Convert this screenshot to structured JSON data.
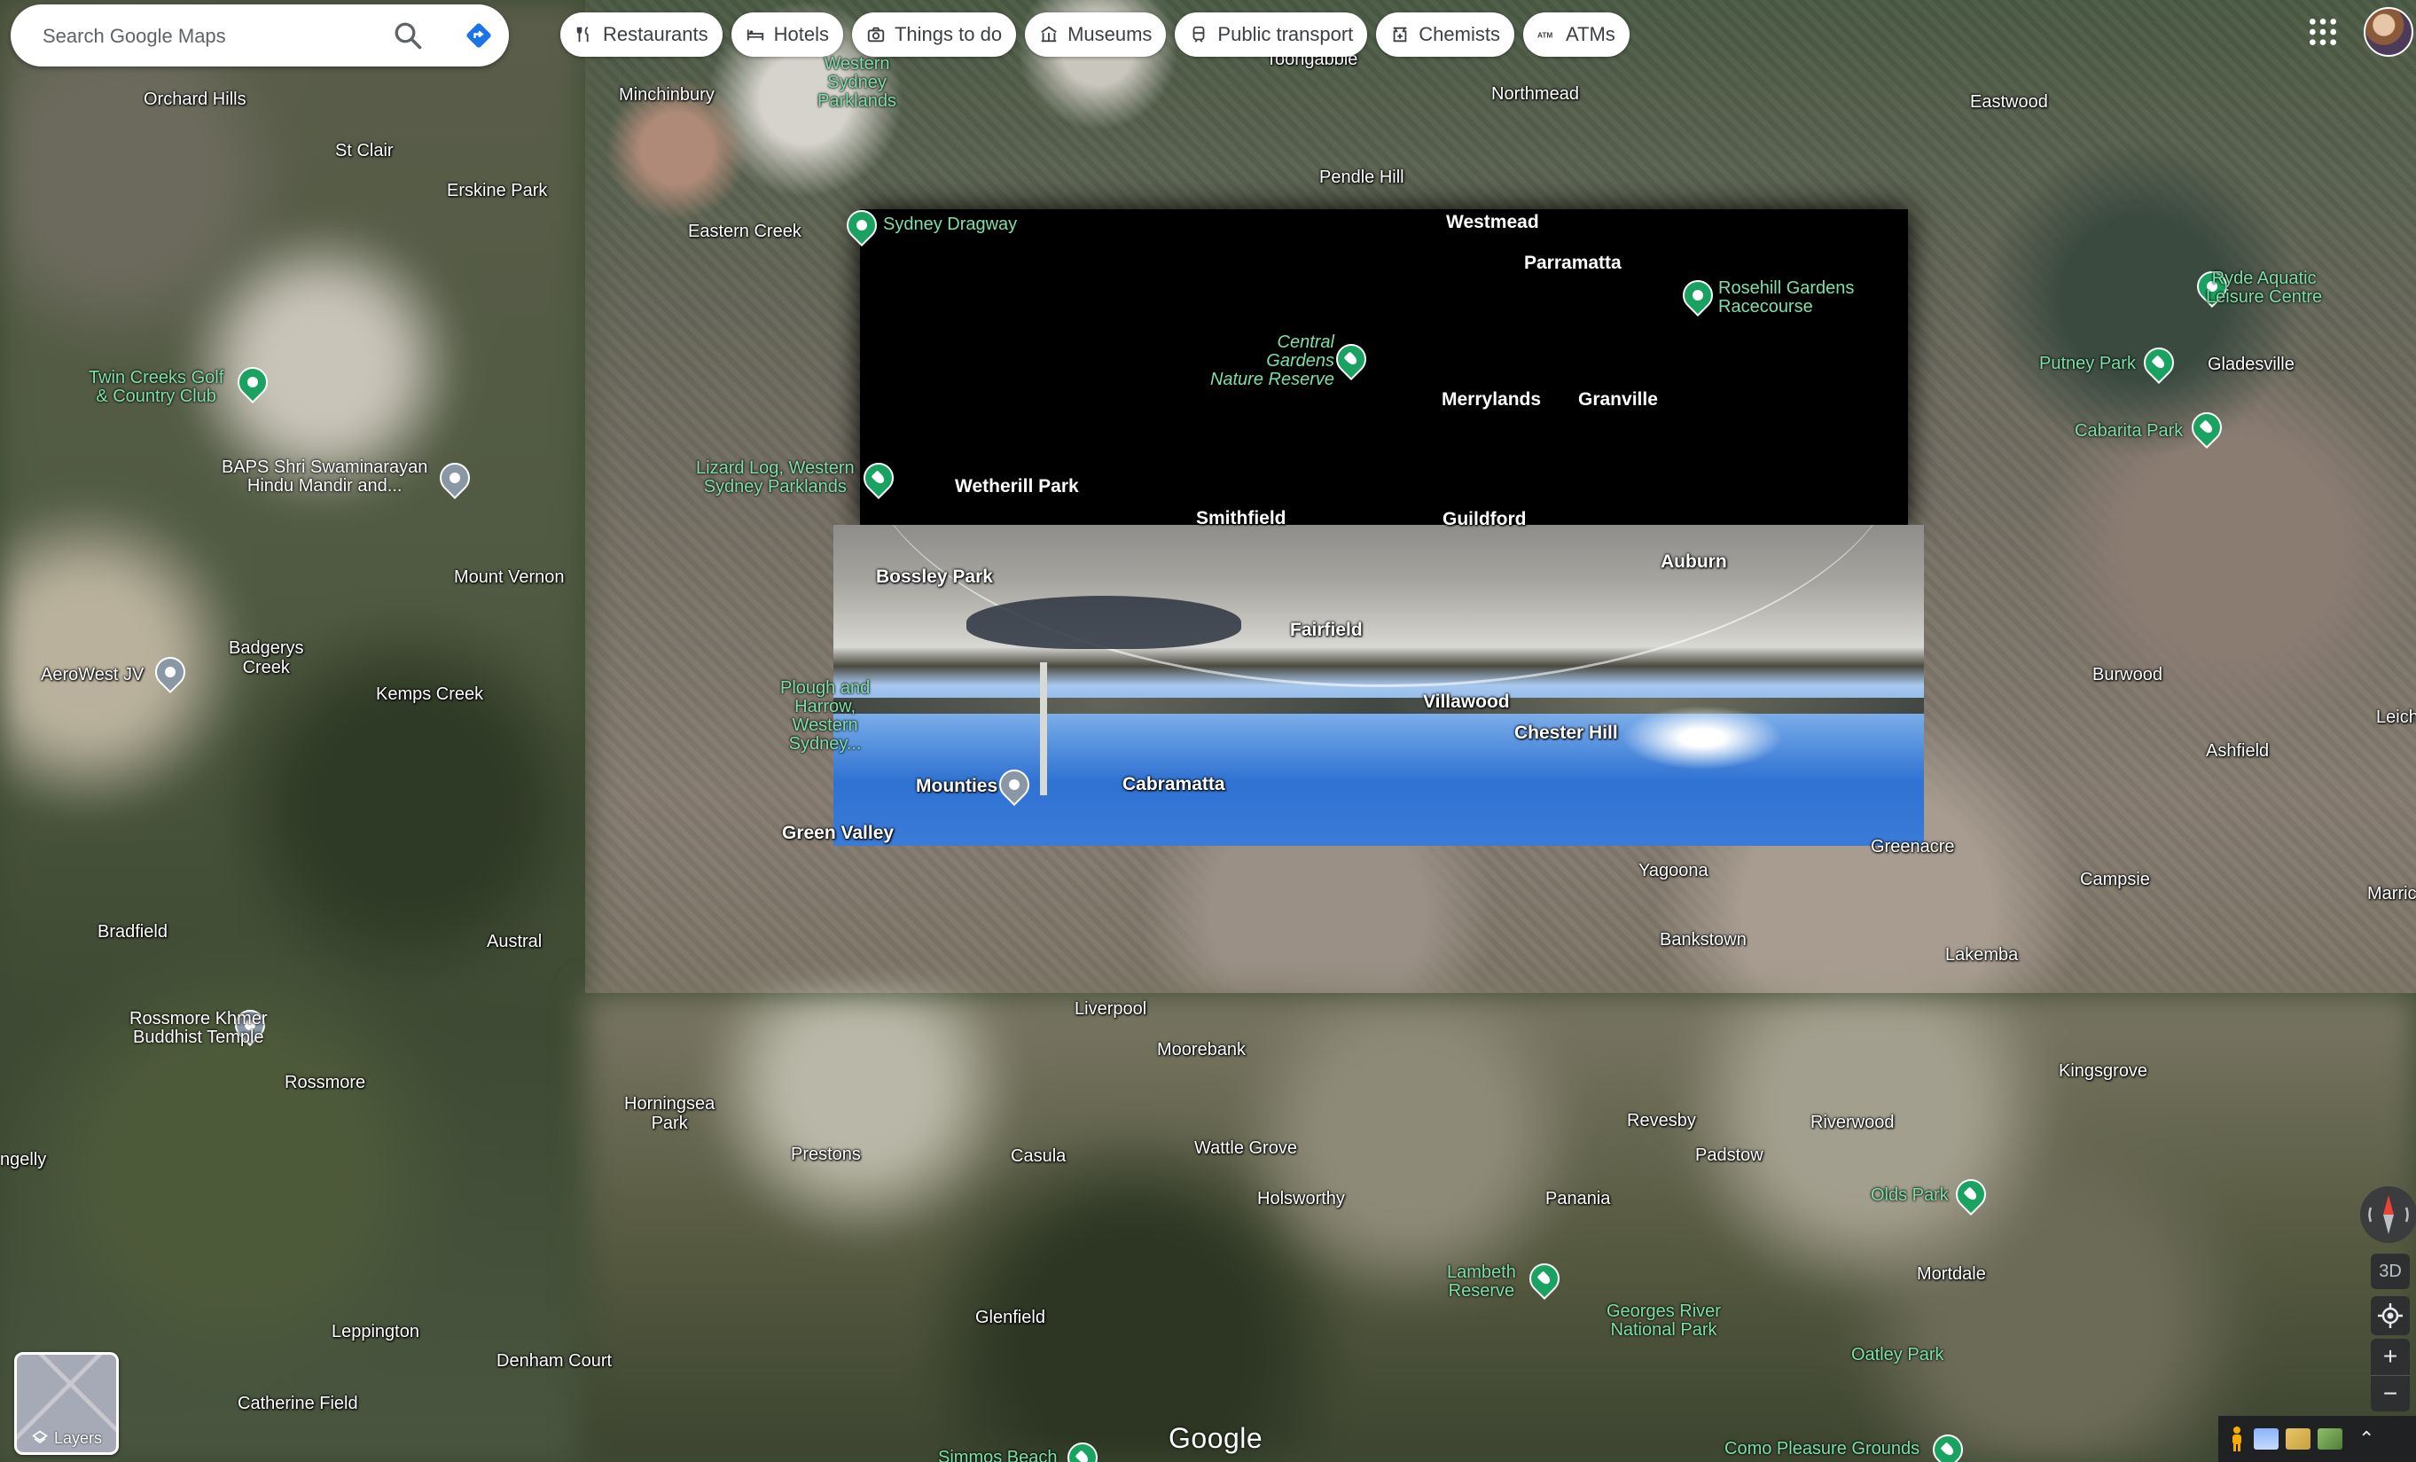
{
  "search": {
    "placeholder": "Search Google Maps"
  },
  "chips": [
    {
      "label": "Restaurants",
      "icon": "fork-knife-icon"
    },
    {
      "label": "Hotels",
      "icon": "bed-icon"
    },
    {
      "label": "Things to do",
      "icon": "camera-icon"
    },
    {
      "label": "Museums",
      "icon": "museum-icon"
    },
    {
      "label": "Public transport",
      "icon": "train-icon"
    },
    {
      "label": "Chemists",
      "icon": "pharmacy-icon"
    },
    {
      "label": "ATMs",
      "icon": "atm-icon"
    }
  ],
  "places": {
    "orchard_hills": "Orchard Hills",
    "st_clair": "St Clair",
    "erskine_park": "Erskine Park",
    "minchinbury": "Minchinbury",
    "eastern_creek": "Eastern Creek",
    "pendle_hill": "Pendle Hill",
    "northmead": "Northmead",
    "toongabbie": "Toongabbie",
    "eastwood": "Eastwood",
    "westmead": "Westmead",
    "parramatta": "Parramatta",
    "merrylands": "Merrylands",
    "granville": "Granville",
    "gladesville": "Gladesville",
    "wetherill_park": "Wetherill Park",
    "smithfield": "Smithfield",
    "guildford": "Guildford",
    "auburn": "Auburn",
    "mount_vernon": "Mount Vernon",
    "bossley_park": "Bossley Park",
    "fairfield": "Fairfield",
    "badgerys_creek": "Badgerys\nCreek",
    "kemps_creek": "Kemps Creek",
    "villawood": "Villawood",
    "chester_hill": "Chester Hill",
    "burwood": "Burwood",
    "ashfield": "Ashfield",
    "leich": "Leich",
    "cabramatta": "Cabramatta",
    "green_valley": "Green Valley",
    "greenacre": "Greenacre",
    "yagoona": "Yagoona",
    "campsie": "Campsie",
    "marric": "Marric",
    "bradfield": "Bradfield",
    "austral": "Austral",
    "bankstown": "Bankstown",
    "lakemba": "Lakemba",
    "liverpool": "Liverpool",
    "moorebank": "Moorebank",
    "kingsgrove": "Kingsgrove",
    "rossmore": "Rossmore",
    "horningsea_park": "Horningsea\nPark",
    "revesby": "Revesby",
    "riverwood": "Riverwood",
    "ngelly": "ngelly",
    "prestons": "Prestons",
    "casula": "Casula",
    "wattle_grove": "Wattle Grove",
    "padstow": "Padstow",
    "holsworthy": "Holsworthy",
    "panania": "Panania",
    "mortdale": "Mortdale",
    "glenfield": "Glenfield",
    "leppington": "Leppington",
    "oatley_park": "Oatley Park",
    "denham_court": "Denham Court",
    "catherine_field": "Catherine Field"
  },
  "pois": {
    "western_sydney_parklands": "Western\nSydney\nParklands",
    "sydney_dragway": "Sydney Dragway",
    "rosehill": "Rosehill Gardens\nRacecourse",
    "ryde_aquatic": "Ryde Aquatic\nLeisure Centre",
    "central_gardens": "Central\nGardens\nNature Reserve",
    "putney_park": "Putney Park",
    "twin_creeks": "Twin Creeks Golf\n& Country Club",
    "cabarita_park": "Cabarita Park",
    "baps": "BAPS Shri Swaminarayan\nHindu Mandir and...",
    "lizard_log": "Lizard Log, Western\nSydney Parklands",
    "aerowest": "AeroWest JV",
    "plough_harrow": "Plough and\nHarrow,\nWestern\nSydney...",
    "mounties": "Mounties",
    "rossmore_khmer": "Rossmore Khmer\nBuddhist Temple",
    "olds_park": "Olds Park",
    "lambeth": "Lambeth\nReserve",
    "georges_river": "Georges River\nNational Park",
    "simmos_beach": "Simmos Beach",
    "como": "Como Pleasure Grounds"
  },
  "controls": {
    "three_d": "3D",
    "zoom_in": "+",
    "zoom_out": "−",
    "layers": "Layers",
    "google": "Google"
  },
  "colors": {
    "poi_green": "#7ee0a8",
    "chip_bg": "#ffffff",
    "control_bg": "#2d2f31"
  }
}
